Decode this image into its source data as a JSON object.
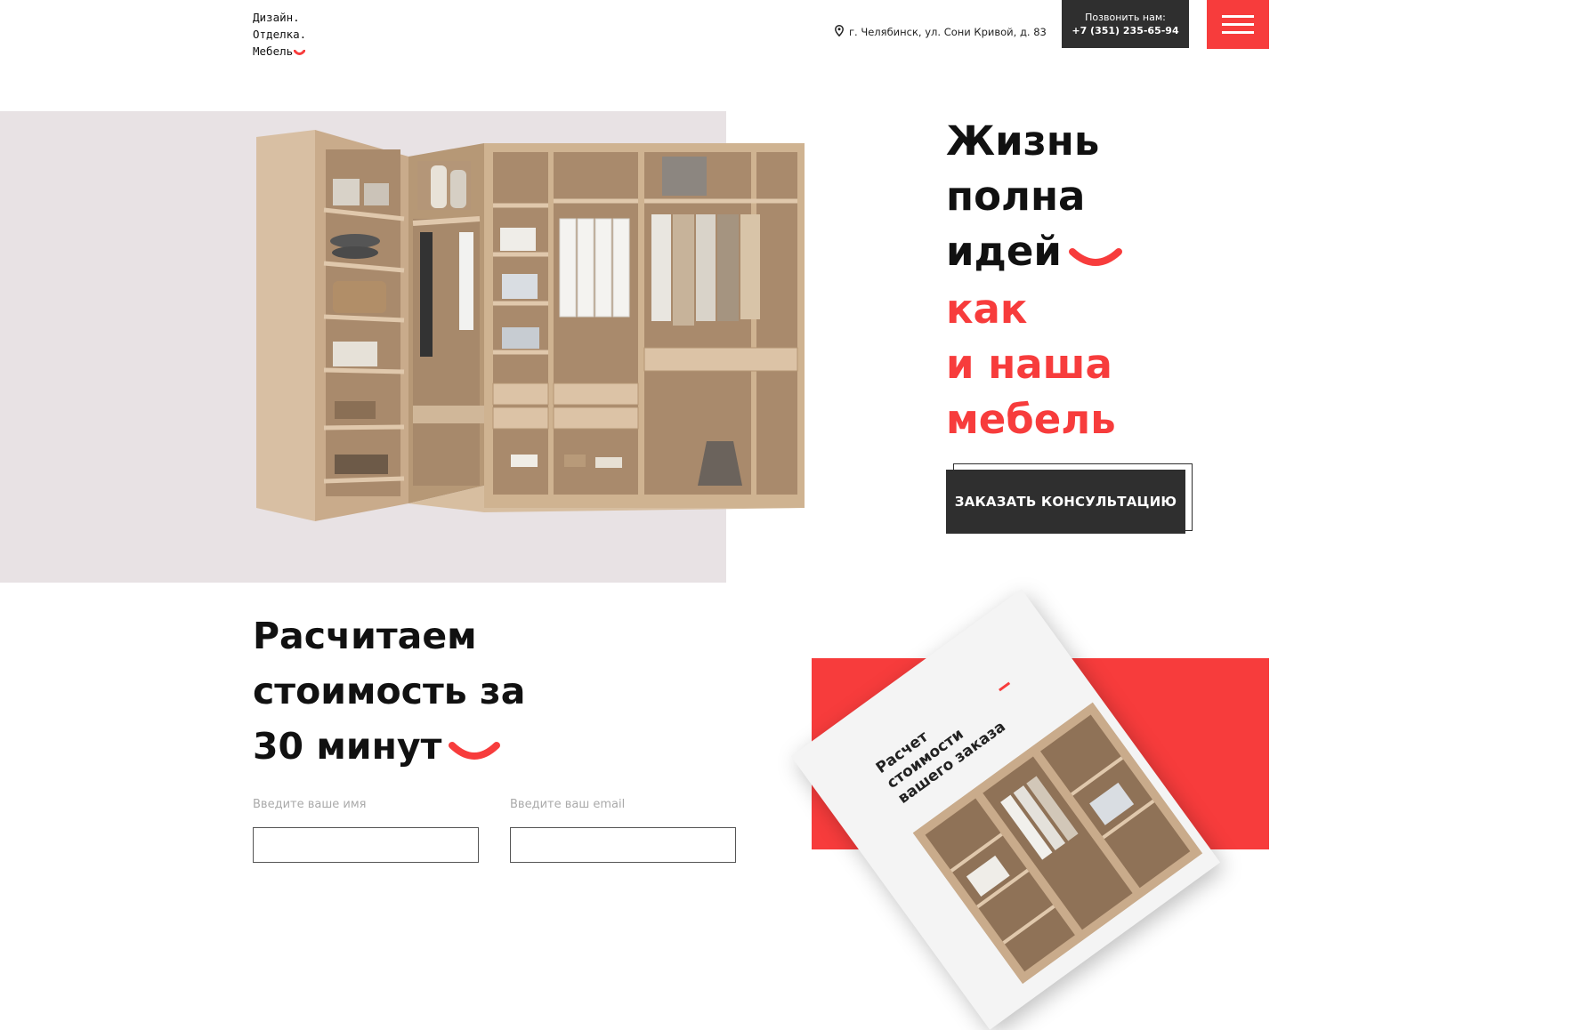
{
  "header": {
    "logo_lines": [
      "Дизайн.",
      "Отделка.",
      "Мебель"
    ],
    "address_icon": "location-pin-icon",
    "address": "г. Челябинск, ул. Сони Кривой, д. 83",
    "call_label": "Позвонить нам:",
    "phone": "+7 (351) 235-65-94",
    "menu_icon": "hamburger-menu-icon"
  },
  "hero": {
    "headline_black": [
      "Жизнь",
      "полна",
      "идей"
    ],
    "headline_red": [
      "как",
      "и наша",
      "мебель"
    ],
    "cta_label": "ЗАКАЗАТЬ КОНСУЛЬТАЦИЮ"
  },
  "calc": {
    "title_lines": [
      "Расчитаем",
      "стоимость за",
      "30 минут"
    ],
    "name_label": "Введите ваше имя",
    "email_label": "Введите ваш email",
    "name_value": "",
    "email_value": "",
    "brochure_lines": [
      "Расчет",
      "стоимости",
      "вашего заказа"
    ]
  },
  "colors": {
    "accent": "#f73c3c",
    "dark": "#2f2f2f",
    "hero_bg": "#e8e2e4"
  }
}
